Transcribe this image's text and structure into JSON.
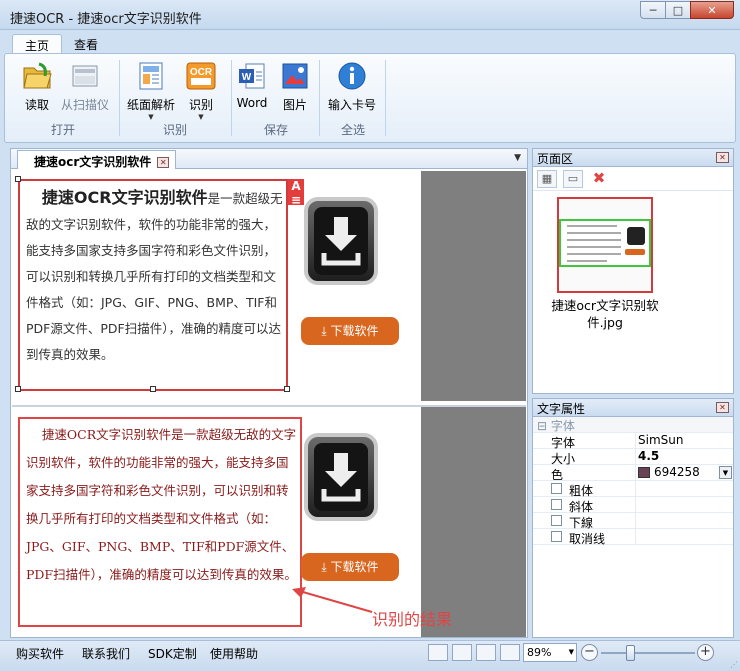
{
  "window": {
    "title": "捷速OCR - 捷速ocr文字识别软件",
    "minimize": "─",
    "maximize": "□",
    "close": "✕"
  },
  "ribbon": {
    "tabs": [
      {
        "label": "主页"
      },
      {
        "label": "查看"
      }
    ],
    "groups": [
      {
        "label": "打开",
        "buttons": [
          {
            "label": "读取",
            "icon": "folder-open-icon"
          },
          {
            "label": "从扫描仪",
            "icon": "scanner-icon"
          }
        ]
      },
      {
        "label": "识别",
        "buttons": [
          {
            "label": "纸面解析",
            "icon": "page-layout-icon"
          },
          {
            "label": "识别",
            "icon": "ocr-icon"
          }
        ]
      },
      {
        "label": "保存",
        "buttons": [
          {
            "label": "Word",
            "icon": "word-icon"
          },
          {
            "label": "图片",
            "icon": "image-icon"
          }
        ]
      },
      {
        "label": "全选",
        "buttons": [
          {
            "label": "输入卡号",
            "icon": "info-icon"
          }
        ]
      }
    ],
    "ocr_icon_text": "OCR"
  },
  "document": {
    "tab_label": "捷速ocr文字识别软件",
    "original": {
      "lead": "捷速OCR文字识别软件",
      "body": "是一款超级无敌的文字识别软件，软件的功能非常的强大，能支持多国家支持多国字符和彩色文件识别，可以识别和转换几乎所有打印的文档类型和文件格式（如：JPG、GIF、PNG、BMP、TIF和PDF源文件、PDF扫描件），准确的精度可以达到传真的效果。"
    },
    "badge": "A",
    "download_button": "下载软件",
    "recognized": {
      "text": "捷速OCR文字识别软件是一款超级无敌的文字识别软件，软件的功能非常的强大，能支持多国家支持多国字符和彩色文件识别，可以识别和转换几乎所有打印的文档类型和文件格式（如：JPG、GIF、PNG、BMP、TIF和PDF源文件、PDF扫描件），准确的精度可以达到传真的效果。"
    },
    "annotation": "识别的结果"
  },
  "pages_pane": {
    "title": "页面区",
    "thumb_caption": "捷速ocr文字识别软件.jpg"
  },
  "props_pane": {
    "title": "文字属性",
    "category": "字体",
    "rows": [
      {
        "key": "字体",
        "value": "SimSun"
      },
      {
        "key": "大小",
        "value": "4.5"
      },
      {
        "key": "色",
        "value": "694258"
      }
    ],
    "checks": [
      {
        "label": "粗体"
      },
      {
        "label": "斜体"
      },
      {
        "label": "下線"
      },
      {
        "label": "取消线"
      }
    ],
    "color_hex": "#694258"
  },
  "statusbar": {
    "links": [
      {
        "label": "购买软件"
      },
      {
        "label": "联系我们"
      },
      {
        "label": "SDK定制"
      },
      {
        "label": "使用帮助"
      }
    ],
    "zoom": "89%"
  }
}
